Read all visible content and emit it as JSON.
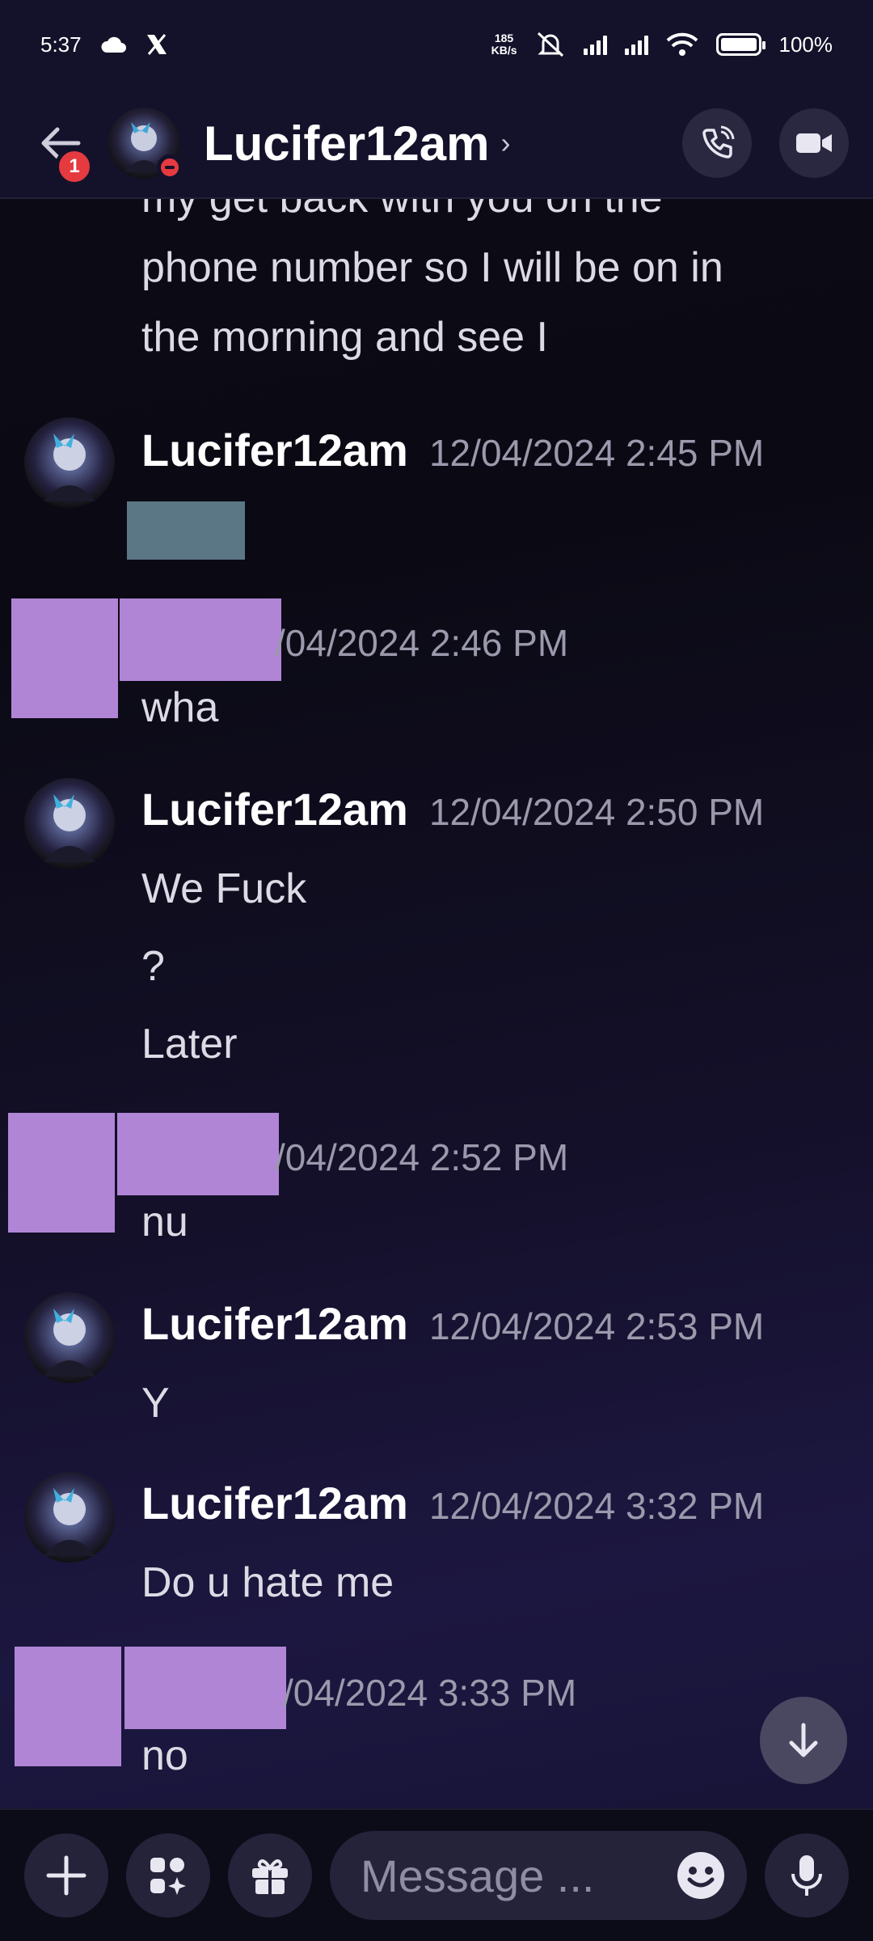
{
  "status_bar": {
    "time": "5:37",
    "netspeed_value": "185",
    "netspeed_unit": "KB/s",
    "battery": "100%",
    "battery_level": 1.0
  },
  "header": {
    "back_badge": "1",
    "title": "Lucifer12am",
    "chevron": "›"
  },
  "messages": {
    "top_continued": [
      "my get back with you on the",
      "phone number so I will be on in",
      "the morning and see I"
    ],
    "groups": [
      {
        "author": "Lucifer12am",
        "time": "12/04/2024 2:45 PM"
      },
      {
        "time_partial": "/04/2024 2:46 PM",
        "lines": [
          "wha"
        ]
      },
      {
        "author": "Lucifer12am",
        "time": "12/04/2024 2:50 PM",
        "lines": [
          "We Fuck",
          "?",
          "Later"
        ]
      },
      {
        "time_partial": "/04/2024 2:52 PM",
        "lines": [
          "nu"
        ]
      },
      {
        "author": "Lucifer12am",
        "time": "12/04/2024 2:53 PM",
        "lines": [
          "Y"
        ]
      },
      {
        "author": "Lucifer12am",
        "time": "12/04/2024 3:32 PM",
        "lines": [
          "Do u hate me"
        ]
      },
      {
        "time_partial": "/04/2024 3:33 PM",
        "lines": [
          "no"
        ]
      }
    ]
  },
  "composer": {
    "placeholder": "Message ..."
  },
  "icons": {
    "cloud": "cloud-icon",
    "x_logo": "x-logo-icon",
    "mute": "bell-muted-icon",
    "wifi": "wifi-icon",
    "battery": "battery-icon",
    "back": "arrow-left-icon",
    "call": "phone-icon",
    "video": "video-camera-icon",
    "scroll": "arrow-down-icon",
    "plus": "plus-icon",
    "apps": "apps-icon",
    "gift": "gift-icon",
    "emoji": "emoji-icon",
    "mic": "microphone-icon"
  },
  "colors": {
    "background": "#0b0a14",
    "header": "#14122a",
    "redaction": "#b085d6",
    "dnd": "#e53a3f"
  }
}
